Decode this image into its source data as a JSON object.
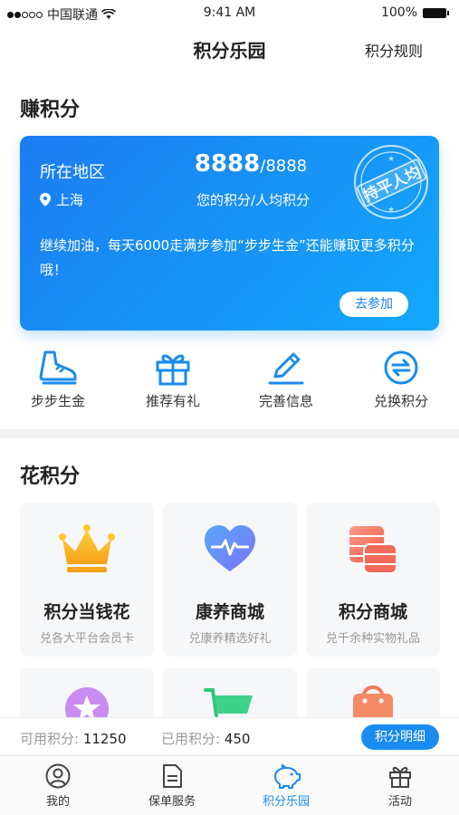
{
  "status_bar": {
    "carrier": "中国联通",
    "time": "9:41 AM",
    "battery": "100%"
  },
  "nav": {
    "title": "积分乐园",
    "rules": "积分规则"
  },
  "earn": {
    "section_title": "赚积分",
    "card": {
      "region_label": "所在地区",
      "city": "上海",
      "my_points": "8888",
      "avg_points": "/8888",
      "points_label": "您的积分/人均积分",
      "message": "继续加油，每天6000走满步参加“步步生金”还能赚取更多积分哦！",
      "join_button": "去参加",
      "stamp_text": "持平人均"
    },
    "features": [
      {
        "label": "步步生金",
        "icon": "shoe-icon"
      },
      {
        "label": "推荐有礼",
        "icon": "gift-icon"
      },
      {
        "label": "完善信息",
        "icon": "pencil-icon"
      },
      {
        "label": "兑换积分",
        "icon": "exchange-icon"
      }
    ]
  },
  "spend": {
    "section_title": "花积分",
    "tiles": [
      {
        "name": "积分当钱花",
        "desc": "兑各大平台会员卡",
        "icon": "crown-icon"
      },
      {
        "name": "康养商城",
        "desc": "兑康养精选好礼",
        "icon": "heart-pulse-icon"
      },
      {
        "name": "积分商城",
        "desc": "兑千余种实物礼品",
        "icon": "coins-icon"
      }
    ]
  },
  "points_bar": {
    "available_label": "可用积分:",
    "available_value": "11250",
    "used_label": "已用积分:",
    "used_value": "450",
    "detail_button": "积分明细"
  },
  "tabbar": [
    {
      "label": "我的",
      "icon": "user-icon"
    },
    {
      "label": "保单服务",
      "icon": "document-icon"
    },
    {
      "label": "积分乐园",
      "icon": "piggy-bank-icon",
      "active": true
    },
    {
      "label": "活动",
      "icon": "gift-icon"
    }
  ],
  "colors": {
    "accent": "#1a8bf0",
    "card_start": "#1b7cf2",
    "card_end": "#13a8fb"
  }
}
